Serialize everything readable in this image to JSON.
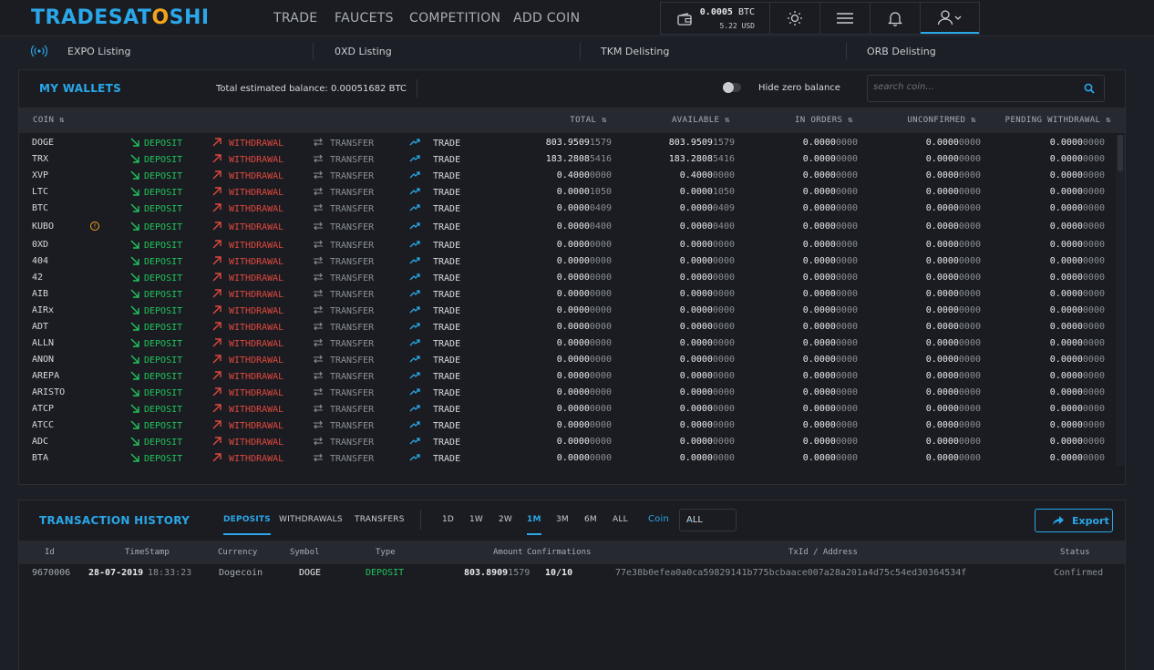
{
  "header": {
    "logo_part1": "TRADESAT",
    "logo_part2": "O",
    "logo_part3": "SHI",
    "nav": [
      "TRADE",
      "FAUCETS",
      "COMPETITION",
      "ADD COIN"
    ],
    "balance_btc_value": "0.0005",
    "balance_btc_unit": "BTC",
    "balance_usd": "5.22 USD"
  },
  "ticker": [
    "EXPO Listing",
    "0XD Listing",
    "TKM Delisting",
    "ORB Delisting"
  ],
  "wallets": {
    "title": "MY WALLETS",
    "estimated_label": "Total estimated balance: 0.00051682 BTC",
    "hide_zero_label": "Hide zero balance",
    "search_placeholder": "search coin...",
    "columns": {
      "coin": "COIN",
      "total": "TOTAL",
      "available": "AVAILABLE",
      "in_orders": "IN ORDERS",
      "unconfirmed": "UNCONFIRMED",
      "pending": "PENDING WITHDRAWAL"
    },
    "actions": {
      "deposit": "DEPOSIT",
      "withdrawal": "WITHDRAWAL",
      "transfer": "TRANSFER",
      "trade": "TRADE"
    },
    "rows": [
      {
        "coin": "DOGE",
        "total_a": "803.9509",
        "total_b": "1579",
        "avail_a": "803.9509",
        "avail_b": "1579"
      },
      {
        "coin": "TRX",
        "total_a": "183.2808",
        "total_b": "5416",
        "avail_a": "183.2808",
        "avail_b": "5416"
      },
      {
        "coin": "XVP",
        "total_a": "0.4000",
        "total_b": "0000",
        "avail_a": "0.4000",
        "avail_b": "0000"
      },
      {
        "coin": "LTC",
        "total_a": "0.0000",
        "total_b": "1050",
        "avail_a": "0.0000",
        "avail_b": "1050"
      },
      {
        "coin": "BTC",
        "total_a": "0.0000",
        "total_b": "0409",
        "avail_a": "0.0000",
        "avail_b": "0409"
      },
      {
        "coin": "KUBO",
        "warning": true,
        "total_a": "0.0000",
        "total_b": "0400",
        "avail_a": "0.0000",
        "avail_b": "0400"
      },
      {
        "coin": "0XD",
        "total_a": "0.0000",
        "total_b": "0000",
        "avail_a": "0.0000",
        "avail_b": "0000"
      },
      {
        "coin": "404",
        "total_a": "0.0000",
        "total_b": "0000",
        "avail_a": "0.0000",
        "avail_b": "0000"
      },
      {
        "coin": "42",
        "total_a": "0.0000",
        "total_b": "0000",
        "avail_a": "0.0000",
        "avail_b": "0000"
      },
      {
        "coin": "AIB",
        "total_a": "0.0000",
        "total_b": "0000",
        "avail_a": "0.0000",
        "avail_b": "0000"
      },
      {
        "coin": "AIRx",
        "total_a": "0.0000",
        "total_b": "0000",
        "avail_a": "0.0000",
        "avail_b": "0000"
      },
      {
        "coin": "ADT",
        "total_a": "0.0000",
        "total_b": "0000",
        "avail_a": "0.0000",
        "avail_b": "0000"
      },
      {
        "coin": "ALLN",
        "total_a": "0.0000",
        "total_b": "0000",
        "avail_a": "0.0000",
        "avail_b": "0000"
      },
      {
        "coin": "ANON",
        "total_a": "0.0000",
        "total_b": "0000",
        "avail_a": "0.0000",
        "avail_b": "0000"
      },
      {
        "coin": "AREPA",
        "total_a": "0.0000",
        "total_b": "0000",
        "avail_a": "0.0000",
        "avail_b": "0000"
      },
      {
        "coin": "ARISTO",
        "total_a": "0.0000",
        "total_b": "0000",
        "avail_a": "0.0000",
        "avail_b": "0000"
      },
      {
        "coin": "ATCP",
        "total_a": "0.0000",
        "total_b": "0000",
        "avail_a": "0.0000",
        "avail_b": "0000"
      },
      {
        "coin": "ATCC",
        "total_a": "0.0000",
        "total_b": "0000",
        "avail_a": "0.0000",
        "avail_b": "0000"
      },
      {
        "coin": "ADC",
        "total_a": "0.0000",
        "total_b": "0000",
        "avail_a": "0.0000",
        "avail_b": "0000"
      },
      {
        "coin": "BTA",
        "total_a": "0.0000",
        "total_b": "0000",
        "avail_a": "0.0000",
        "avail_b": "0000"
      }
    ],
    "zero_a": "0.0000",
    "zero_b": "0000"
  },
  "transactions": {
    "title": "TRANSACTION HISTORY",
    "tabs": [
      "DEPOSITS",
      "WITHDRAWALS",
      "TRANSFERS"
    ],
    "periods": [
      "1D",
      "1W",
      "2W",
      "1M",
      "3M",
      "6M",
      "ALL"
    ],
    "active_period": "1M",
    "coin_label": "Coin",
    "coin_select": "ALL",
    "export_label": "Export",
    "columns": [
      "Id",
      "TimeStamp",
      "Currency",
      "Symbol",
      "Type",
      "Amount",
      "Confirmations",
      "TxId / Address",
      "Status"
    ],
    "rows": [
      {
        "id": "9670006",
        "date": "28-07-2019",
        "time": "18:33:23",
        "currency": "Dogecoin",
        "symbol": "DOGE",
        "type": "DEPOSIT",
        "amount_a": "803.8909",
        "amount_b": "1579",
        "confirmations": "10/10",
        "txid": "77e38b0efea0a0ca59829141b775bcbaace007a28a201a4d75c54ed30364534f",
        "status": "Confirmed"
      }
    ]
  },
  "colors": {
    "accent": "#2aa7e8",
    "deposit": "#21c35b",
    "withdrawal": "#e0483d",
    "logo_orange": "#f2a41c"
  }
}
